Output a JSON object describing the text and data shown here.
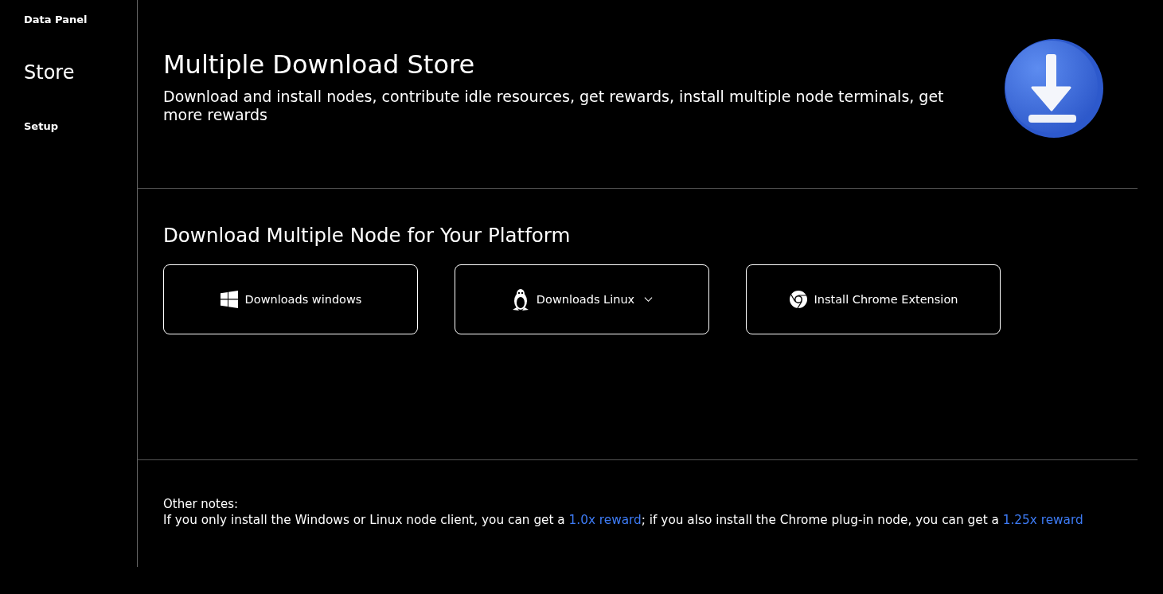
{
  "sidebar": {
    "items": [
      {
        "label": "Data Panel",
        "selected": false
      },
      {
        "label": "Store",
        "selected": true
      },
      {
        "label": "Setup",
        "selected": false
      }
    ]
  },
  "header": {
    "title": "Multiple Download Store",
    "description": "Download and install nodes, contribute idle resources, get rewards, install multiple node terminals, get more rewards"
  },
  "downloads": {
    "heading": "Download Multiple Node for Your Platform",
    "buttons": [
      {
        "kind": "windows",
        "label": "Downloads windows",
        "dropdown": false
      },
      {
        "kind": "linux",
        "label": "Downloads Linux",
        "dropdown": true
      },
      {
        "kind": "chrome",
        "label": "Install Chrome Extension",
        "dropdown": false
      }
    ]
  },
  "notes": {
    "title": "Other notes:",
    "parts": [
      {
        "kind": "plain",
        "text": "If you only install the Windows or Linux node client, you can get a "
      },
      {
        "kind": "link",
        "text": "1.0x reward"
      },
      {
        "kind": "plain",
        "text": "; if you also install the Chrome plug-in node, you can get a "
      },
      {
        "kind": "link",
        "text": "1.25x reward"
      }
    ]
  }
}
